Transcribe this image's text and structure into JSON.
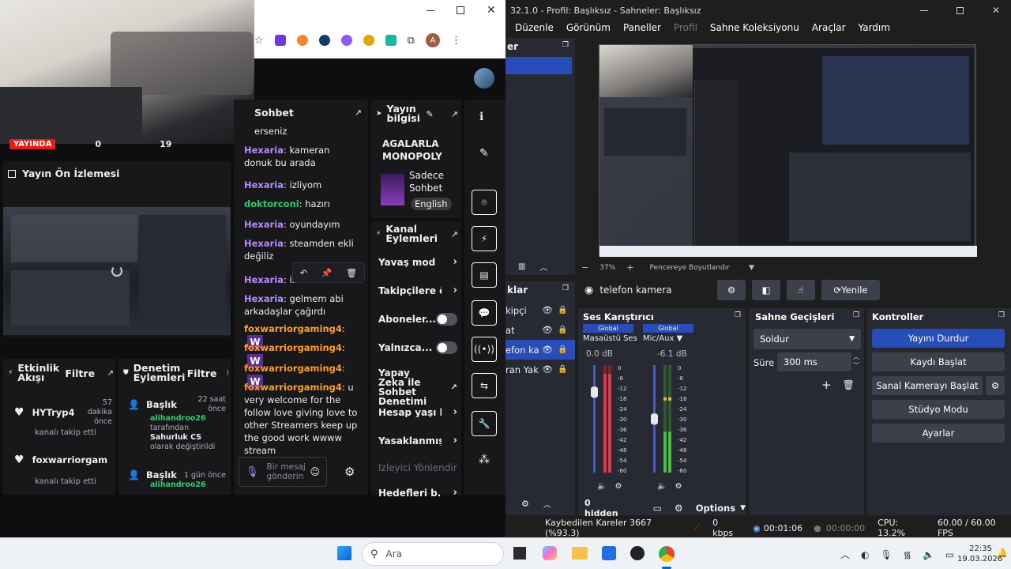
{
  "twitch": {
    "live_badge": "YAYINDA",
    "live_stats": [
      "0",
      "19"
    ],
    "preview_title": "Yayın Ön İzlemesi",
    "chat": {
      "title": "Sohbet",
      "partial_top": "erseniz",
      "messages": [
        {
          "user": "Hexaria",
          "text": ": kameran donuk bu arada",
          "color": "hex"
        },
        {
          "user": "Hexaria",
          "text": ": izliyom",
          "color": "hex"
        },
        {
          "user": "doktorconi",
          "text": ": hazırı",
          "color": "dok"
        },
        {
          "user": "Hexaria",
          "text": ": oyundayım",
          "color": "hex"
        },
        {
          "user": "Hexaria",
          "text": ": steamden ekli değiliz",
          "color": "hex"
        },
        {
          "user": "Hexaria",
          "text": ": iste",
          "color": "hex"
        },
        {
          "user": "Hexaria",
          "text": ": gelmem abi arkadaşlar çağırdı",
          "color": "hex"
        },
        {
          "user": "foxwarriorgaming4",
          "text": ":",
          "color": "fox"
        },
        {
          "user": "foxwarriorgaming4",
          "text": ":",
          "color": "fox"
        },
        {
          "user": "foxwarriorgaming4",
          "text": ":",
          "color": "fox"
        },
        {
          "user": "foxwarriorgaming4",
          "text": ": u very welcome for the follow love giving love to other Streamers keep up the good work wwww stream",
          "color": "fox"
        }
      ],
      "input_placeholder": "Bir mesaj gönderin"
    },
    "stream_info": {
      "title": "Yayın bilgisi",
      "stream_name": "AGALARLA MONOPOLY",
      "category": "Sadece Sohbet",
      "language": "English"
    },
    "channel_actions": {
      "title": "Kanal Eylemleri",
      "items": [
        "Yavaş mod",
        "Takipçilere öz",
        "Aboneler...",
        "Yalnızca...",
        "Yapay Zeka ile Sohbet Denetimi",
        "Hesap yaşı kı:",
        "Yasaklanmış l",
        "İzleyici Yönlendir",
        "Hedefleri b..."
      ]
    },
    "activity": {
      "title": "Etkinlik Akışı",
      "filter": "Filtre",
      "items": [
        {
          "name": "HYTryp4",
          "sub": "kanalı takip etti",
          "time": "57 dakika önce"
        },
        {
          "name": "foxwarriorgamir",
          "sub": "kanalı takip etti",
          "time": ""
        }
      ]
    },
    "moderation": {
      "title": "Denetim Eylemleri",
      "filter": "Filtre",
      "items": [
        {
          "title": "Başlık",
          "time": "22 saat önce",
          "user": "alihandroo26",
          "l1": "tarafından",
          "l2": "Sahurluk CS",
          "l3": "olarak değiştirildi"
        },
        {
          "title": "Başlık",
          "time": "1 gün önce",
          "user": "alihandroo26"
        }
      ]
    }
  },
  "obs": {
    "title": "32.1.0 - Profil: Başlıksız - Sahneler: Başlıksız",
    "menu": [
      "Düzenle",
      "Görünüm",
      "Paneller",
      "Profil",
      "Sahne Koleksiyonu",
      "Araçlar",
      "Yardım"
    ],
    "zoom": "37%",
    "window_fit": "Pencereye Boyutlandır",
    "sources_header": "klar",
    "sources": [
      "kipçi",
      "at",
      "efon ka",
      "ran Yak"
    ],
    "source_label": "telefon kamera",
    "refresh": "Yenile",
    "mixer": {
      "title": "Ses Karıştırıcı",
      "channels": [
        {
          "global": "Global",
          "name": "Masaüstü Ses",
          "db": "0.0 dB",
          "level": 0.8
        },
        {
          "global": "Global",
          "name": "Mic/Aux",
          "db": "-6.1 dB",
          "level": 0.55
        }
      ],
      "scale": [
        "0",
        "-6",
        "-12",
        "-18",
        "-24",
        "-30",
        "-36",
        "-42",
        "-48",
        "-54",
        "-60"
      ],
      "hidden": "0 hidden",
      "options": "Options"
    },
    "transitions": {
      "title": "Sahne Geçişleri",
      "value": "Soldur",
      "duration_label": "Süre",
      "duration": "300 ms"
    },
    "controls": {
      "title": "Kontroller",
      "buttons": [
        "Yayını Durdur",
        "Kaydı Başlat",
        "Sanal Kamerayı Başlat",
        "Stüdyo Modu",
        "Ayarlar"
      ]
    },
    "status": {
      "dropped": "Kaybedilen Kareler 3667 (%93.3)",
      "kbps": "0 kbps",
      "stream_time": "00:01:06",
      "rec_time": "00:00:00",
      "cpu": "CPU: 13.2%",
      "fps": "60.00 / 60.00 FPS"
    }
  },
  "taskbar": {
    "search": "Ara",
    "time": "22:35",
    "date": "19.03.2026"
  },
  "colors": {
    "twitch_purple": "#9147ff",
    "obs_blue": "#284cb8",
    "meter_green": "#44c13f",
    "meter_red": "#e2364b"
  }
}
